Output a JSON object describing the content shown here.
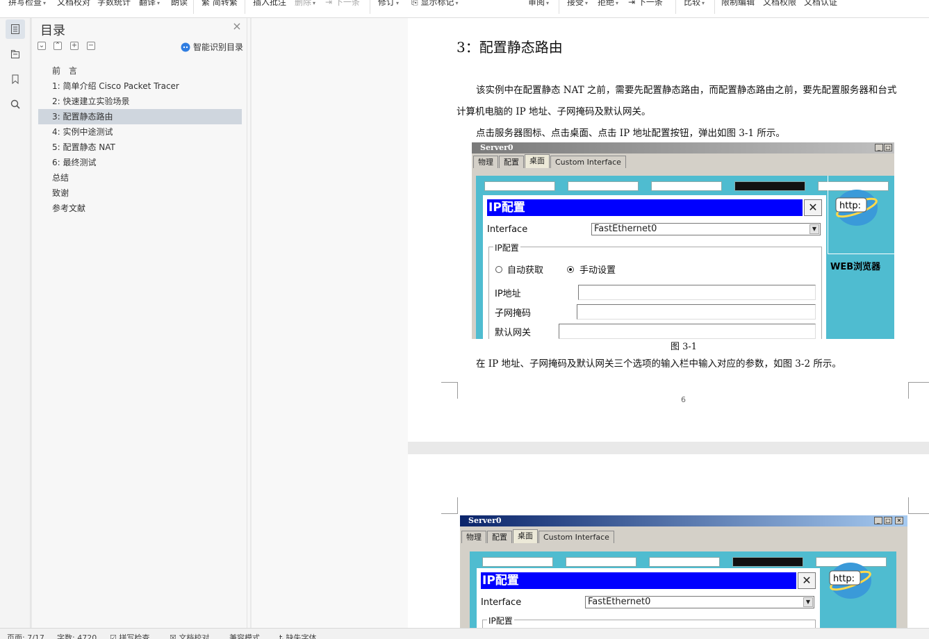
{
  "toolbar": {
    "items": [
      {
        "label": "拼写检查",
        "caret": true
      },
      {
        "label": "文档校对",
        "caret": false
      },
      {
        "label": "字数统计",
        "caret": false
      },
      {
        "label": "翻译",
        "caret": true
      },
      {
        "label": "朗读",
        "caret": false
      },
      {
        "label": "简转繁",
        "caret": false
      },
      {
        "label": "插入批注",
        "caret": false
      },
      {
        "label": "删除",
        "caret": true
      },
      {
        "label": "下一条",
        "caret": false
      },
      {
        "label": "修订",
        "caret": true
      },
      {
        "label": "显示标记",
        "caret": true
      },
      {
        "label": "审阅",
        "caret": true
      },
      {
        "label": "接受",
        "caret": true
      },
      {
        "label": "拒绝",
        "caret": true
      },
      {
        "label": "下一条",
        "caret": false
      },
      {
        "label": "比较",
        "caret": true
      },
      {
        "label": "限制编辑",
        "caret": false
      },
      {
        "label": "文档权限",
        "caret": false
      },
      {
        "label": "文档认证",
        "caret": false
      }
    ]
  },
  "toc": {
    "title": "目录",
    "smart_label": "智能识别目录",
    "items": [
      "前　言",
      "1: 简单介绍 Cisco Packet Tracer",
      "2: 快速建立实验场景",
      "3: 配置静态路由",
      "4: 实例中途测试",
      "5: 配置静态 NAT",
      "6: 最终测试",
      "总结",
      "致谢",
      "参考文献"
    ],
    "active_index": 3
  },
  "doc": {
    "heading": "3：配置静态路由",
    "para1_line1": "该实例中在配置静态 NAT 之前，需要先配置静态路由，而配置静态路由之前，要先配置服务器和台式",
    "para1_line2": "计算机电脑的 IP 地址、子网掩码及默认网关。",
    "para2": "点击服务器图标、点击桌面、点击 IP 地址配置按钮，弹出如图 3-1 所示。",
    "caption": "图 3-1",
    "para3": "在 IP 地址、子网掩码及默认网关三个选项的输入栏中输入对应的参数，如图 3-2 所示。",
    "page_number": "6"
  },
  "figure": {
    "window_title": "Server0",
    "tabs": [
      "物理",
      "配置",
      "桌面",
      "Custom Interface"
    ],
    "selected_tab_index": 2,
    "dialog_title": "IP配置",
    "interface_label": "Interface",
    "interface_value": "FastEthernet0",
    "group_label": "IP配置",
    "radio_dhcp": "自动获取",
    "radio_static": "手动设置",
    "ip_label": "IP地址",
    "mask_label": "子网掩码",
    "gateway_label": "默认网关",
    "http_label": "http:",
    "web_browser_label": "WEB浏览器"
  },
  "status": {
    "page": "页面: 7/17",
    "words": "字数: 4720",
    "spell": "拼写检查",
    "proof": "文档校对",
    "compat": "兼容模式",
    "font_missing": "缺失字体"
  },
  "colors": {
    "toc_active": "#cfd6de",
    "dialog_title_bg": "#0000ff",
    "desktop_bg": "#4fbcd0",
    "accent": "#2f7de1"
  }
}
